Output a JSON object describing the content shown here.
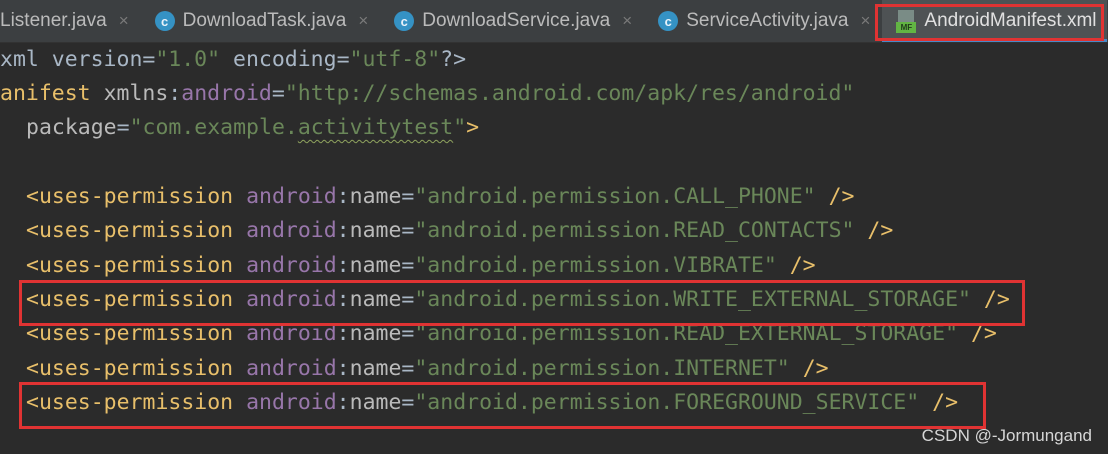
{
  "tabs": [
    {
      "label": "Listener.java",
      "icon": "none",
      "active": false
    },
    {
      "label": "DownloadTask.java",
      "icon": "java-class-icon",
      "active": false
    },
    {
      "label": "DownloadService.java",
      "icon": "java-class-icon",
      "active": false
    },
    {
      "label": "ServiceActivity.java",
      "icon": "java-class-icon",
      "active": false
    },
    {
      "label": "AndroidManifest.xml",
      "icon": "manifest-file-icon",
      "active": true
    }
  ],
  "tab_close_glyph": "×",
  "class_icon_letter": "c",
  "manifest_icon_letters": "MF",
  "code": {
    "xml_decl": {
      "a": "xml version=",
      "v1": "\"1.0\"",
      "b": " encoding=",
      "v2": "\"utf-8\"",
      "c": "?>"
    },
    "manifest_open": {
      "tag": "anifest",
      "sp": " ",
      "attr": "xmlns",
      "colon": ":",
      "ns": "android",
      "eq": "=",
      "val": "\"http://schemas.android.com/apk/res/android\""
    },
    "package_line": {
      "attr": "package",
      "eq": "=",
      "val_open": "\"com.example.",
      "val_squig": "activitytest",
      "val_close": "\"",
      "end": ">"
    },
    "permissions": [
      {
        "tag": "<uses-permission",
        "ns": "android",
        "colon": ":",
        "attr": "name",
        "eq": "=",
        "value": "\"android.permission.CALL_PHONE\"",
        "end": " />",
        "highlight": false
      },
      {
        "tag": "<uses-permission",
        "ns": "android",
        "colon": ":",
        "attr": "name",
        "eq": "=",
        "value": "\"android.permission.READ_CONTACTS\"",
        "end": " />",
        "highlight": false
      },
      {
        "tag": "<uses-permission",
        "ns": "android",
        "colon": ":",
        "attr": "name",
        "eq": "=",
        "value": "\"android.permission.VIBRATE\"",
        "end": " />",
        "highlight": false
      },
      {
        "tag": "<uses-permission",
        "ns": "android",
        "colon": ":",
        "attr": "name",
        "eq": "=",
        "value": "\"android.permission.WRITE_EXTERNAL_STORAGE\"",
        "end": " />",
        "highlight": true
      },
      {
        "tag": "<uses-permission",
        "ns": "android",
        "colon": ":",
        "attr": "name",
        "eq": "=",
        "value": "\"android.permission.READ_EXTERNAL_STORAGE\"",
        "end": " />",
        "highlight": false
      },
      {
        "tag": "<uses-permission",
        "ns": "android",
        "colon": ":",
        "attr": "name",
        "eq": "=",
        "value": "\"android.permission.INTERNET\"",
        "end": " />",
        "highlight": false
      },
      {
        "tag": "<uses-permission",
        "ns": "android",
        "colon": ":",
        "attr": "name",
        "eq": "=",
        "value": "\"android.permission.FOREGROUND_SERVICE\"",
        "end": " />",
        "highlight": true
      }
    ]
  },
  "watermark": "CSDN @-Jormungand",
  "colors": {
    "highlight_box": "#e03333",
    "tag": "#e8bf6a",
    "namespace": "#9876aa",
    "string": "#6a8759",
    "background": "#2b2b2b"
  }
}
